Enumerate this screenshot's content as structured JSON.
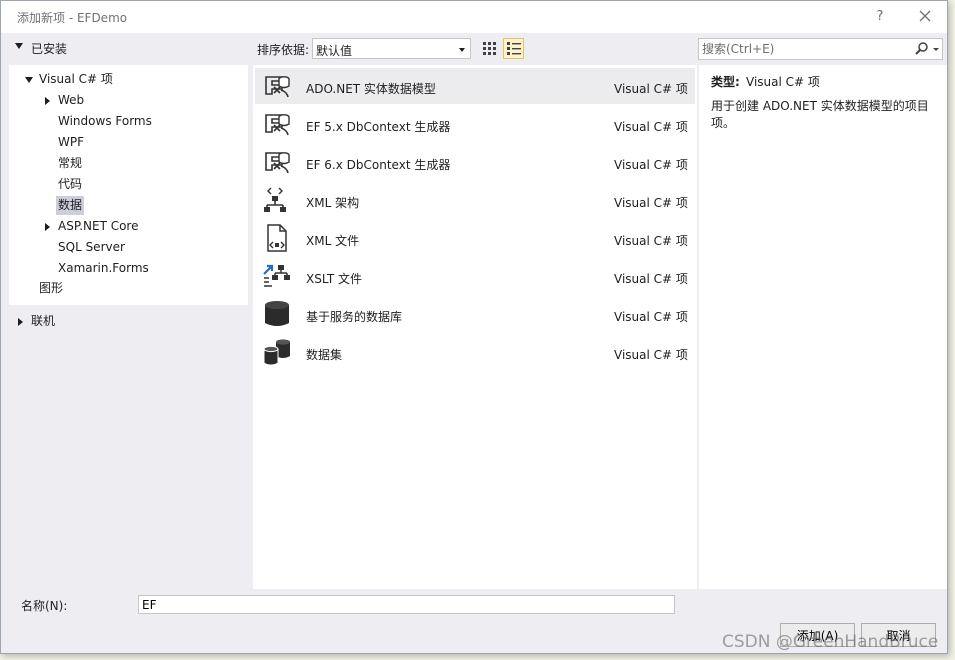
{
  "window": {
    "title": "添加新项 - EFDemo",
    "help_label": "?",
    "close_icon": "close-icon"
  },
  "tree": {
    "installed_label": "已安装",
    "root_label": "Visual C# 项",
    "children": [
      "Web",
      "Windows Forms",
      "WPF",
      "常规",
      "代码",
      "数据",
      "ASP.NET Core",
      "SQL Server",
      "Xamarin.Forms"
    ],
    "graphics_label": "图形",
    "online_label": "联机",
    "selected": "数据"
  },
  "toolbar": {
    "sort_label": "排序依据:",
    "sort_value": "默认值",
    "search_placeholder": "搜索(Ctrl+E)",
    "active_view": "list"
  },
  "templates": [
    {
      "name": "ADO.NET 实体数据模型",
      "lang": "Visual C# 项",
      "icon": "entity-model-icon",
      "selected": true
    },
    {
      "name": "EF 5.x DbContext 生成器",
      "lang": "Visual C# 项",
      "icon": "entity-model-icon"
    },
    {
      "name": "EF 6.x DbContext 生成器",
      "lang": "Visual C# 项",
      "icon": "entity-model-icon"
    },
    {
      "name": "XML 架构",
      "lang": "Visual C# 项",
      "icon": "xml-schema-icon"
    },
    {
      "name": "XML 文件",
      "lang": "Visual C# 项",
      "icon": "xml-file-icon"
    },
    {
      "name": "XSLT 文件",
      "lang": "Visual C# 项",
      "icon": "xslt-file-icon"
    },
    {
      "name": "基于服务的数据库",
      "lang": "Visual C# 项",
      "icon": "database-icon"
    },
    {
      "name": "数据集",
      "lang": "Visual C# 项",
      "icon": "dataset-icon"
    }
  ],
  "info": {
    "type_label": "类型:",
    "type_value": "Visual C# 项",
    "description": "用于创建 ADO.NET 实体数据模型的项目项。"
  },
  "bottom": {
    "name_label": "名称(N):",
    "name_value": "EF",
    "add_label": "添加(A)",
    "cancel_label": "取消"
  },
  "watermark": "CSDN @GreenHandBruce",
  "colors": {
    "accent": "#1e70c1",
    "selection": "#cccedb",
    "dialog_bg": "#eeeef2"
  }
}
